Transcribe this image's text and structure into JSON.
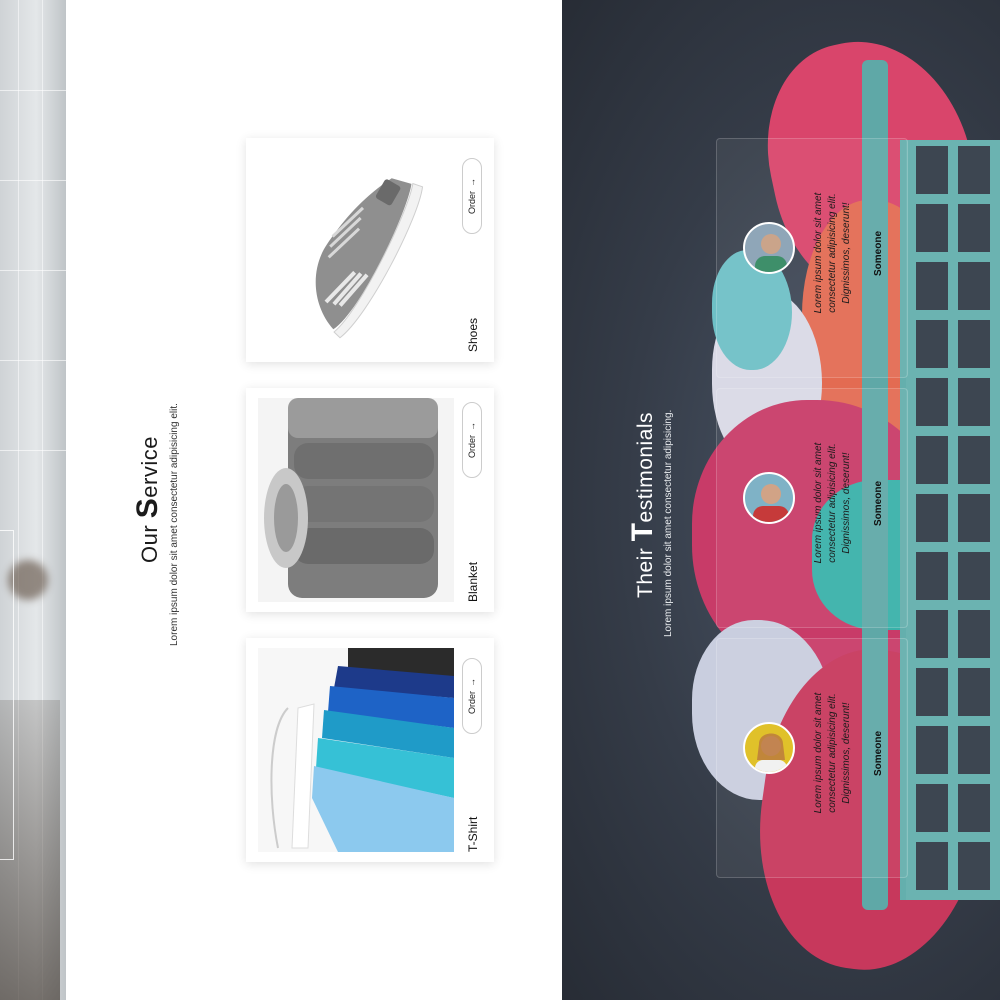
{
  "service": {
    "title_initial": "S",
    "title_rest": "ervice",
    "title_prefix": "Our ",
    "subtitle": "Lorem ipsum dolor sit amet consectetur adipisicing elit.",
    "cards": [
      {
        "label": "Shoes",
        "order": "Order",
        "image": "sneaker-image"
      },
      {
        "label": "Blanket",
        "order": "Order",
        "image": "folded-blanket-image"
      },
      {
        "label": "T-Shirt",
        "order": "Order",
        "image": "tshirts-on-hangers-image"
      }
    ]
  },
  "testimonials": {
    "title_prefix": "Their ",
    "title_initial": "T",
    "title_rest": "estimonials",
    "subtitle": "Lorem ipsum dolor sit amet consectetur adipisicing.",
    "items": [
      {
        "quote": "Lorem ipsum dolor sit amet consectetur adipisicing elit. Dignissimos, deserunt!",
        "name": "Someone",
        "avatar_color": "#8fa6b8"
      },
      {
        "quote": "Lorem ipsum dolor sit amet consectetur adipisicing elit. Dignissimos, deserunt!",
        "name": "Someone",
        "avatar_color": "#c63a3a"
      },
      {
        "quote": "Lorem ipsum dolor sit amet consectetur adipisicing elit. Dignissimos, deserunt!",
        "name": "Someone",
        "avatar_color": "#e0c12a"
      }
    ]
  },
  "colors": {
    "dark_bg": "#353c48",
    "accent_pink": "#d9456b",
    "accent_teal": "#5fa8a7"
  }
}
